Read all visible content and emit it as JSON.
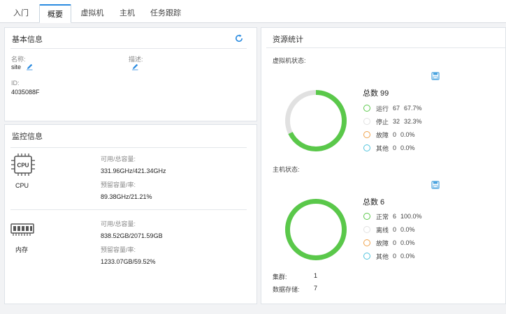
{
  "tabs": [
    {
      "label": "入门",
      "active": false
    },
    {
      "label": "概要",
      "active": true
    },
    {
      "label": "虚拟机",
      "active": false
    },
    {
      "label": "主机",
      "active": false
    },
    {
      "label": "任务跟踪",
      "active": false
    }
  ],
  "basic_info": {
    "title": "基本信息",
    "name_label": "名称:",
    "name_value": "site",
    "desc_label": "描述:",
    "id_label": "ID:",
    "id_value": "4035088F"
  },
  "monitor": {
    "title": "监控信息",
    "cpu": {
      "name": "CPU",
      "chip_text": "CPU",
      "avail_label": "可用/总容量:",
      "avail_value": "331.96GHz/421.34GHz",
      "reserve_label": "预留容量/率:",
      "reserve_value": "89.38GHz/21.21%"
    },
    "memory": {
      "name": "内存",
      "avail_label": "可用/总容量:",
      "avail_value": "838.52GB/2071.59GB",
      "reserve_label": "预留容量/率:",
      "reserve_value": "1233.07GB/59.52%"
    }
  },
  "resources": {
    "title": "资源统计",
    "vm": {
      "label": "虚拟机状态:",
      "total": "总数 99",
      "running_fraction": 0.677,
      "legend": [
        {
          "label": "运行",
          "count": "67",
          "percent": "67.7%",
          "color": "#5ac84a"
        },
        {
          "label": "停止",
          "count": "32",
          "percent": "32.3%",
          "color": "#e1e1e1"
        },
        {
          "label": "故障",
          "count": "0",
          "percent": "0.0%",
          "color": "#f0a24a"
        },
        {
          "label": "其他",
          "count": "0",
          "percent": "0.0%",
          "color": "#4ec3dc"
        }
      ]
    },
    "host": {
      "label": "主机状态:",
      "total": "总数 6",
      "normal_fraction": 1.0,
      "legend": [
        {
          "label": "正常",
          "count": "6",
          "percent": "100.0%",
          "color": "#5ac84a"
        },
        {
          "label": "离线",
          "count": "0",
          "percent": "0.0%",
          "color": "#e1e1e1"
        },
        {
          "label": "故障",
          "count": "0",
          "percent": "0.0%",
          "color": "#f0a24a"
        },
        {
          "label": "其他",
          "count": "0",
          "percent": "0.0%",
          "color": "#4ec3dc"
        }
      ]
    },
    "cluster_label": "集群:",
    "cluster_value": "1",
    "datastore_label": "数据存储:",
    "datastore_value": "7"
  },
  "colors": {
    "accent": "#2a8be0",
    "ring_green": "#5ac84a",
    "ring_gray": "#e1e1e1",
    "save_icon": "#4aa3df"
  },
  "icons": [
    "refresh-icon",
    "edit-icon",
    "cpu-chip-icon",
    "memory-module-icon",
    "save-icon"
  ]
}
